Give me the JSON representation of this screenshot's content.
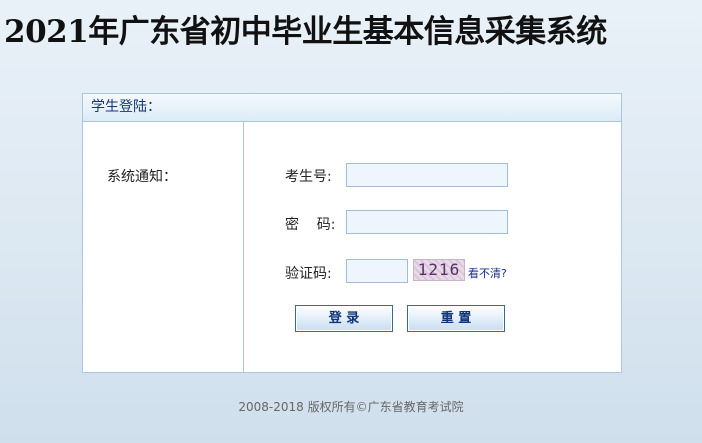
{
  "page": {
    "title": "2021年广东省初中毕业生基本信息采集系统"
  },
  "login_panel": {
    "header": "学生登陆：",
    "notice_label": "系统通知：",
    "fields": {
      "exam_number_label": "考生号:",
      "exam_number_value": "",
      "password_label": "密    码:",
      "password_value": "",
      "captcha_label": "验证码:",
      "captcha_value": ""
    },
    "captcha_image_text": "1216",
    "refresh_captcha": "看不清?",
    "login_button": "登 录",
    "reset_button": "重 置"
  },
  "footer": {
    "copyright": "2008-2018  版权所有©广东省教育考试院"
  }
}
